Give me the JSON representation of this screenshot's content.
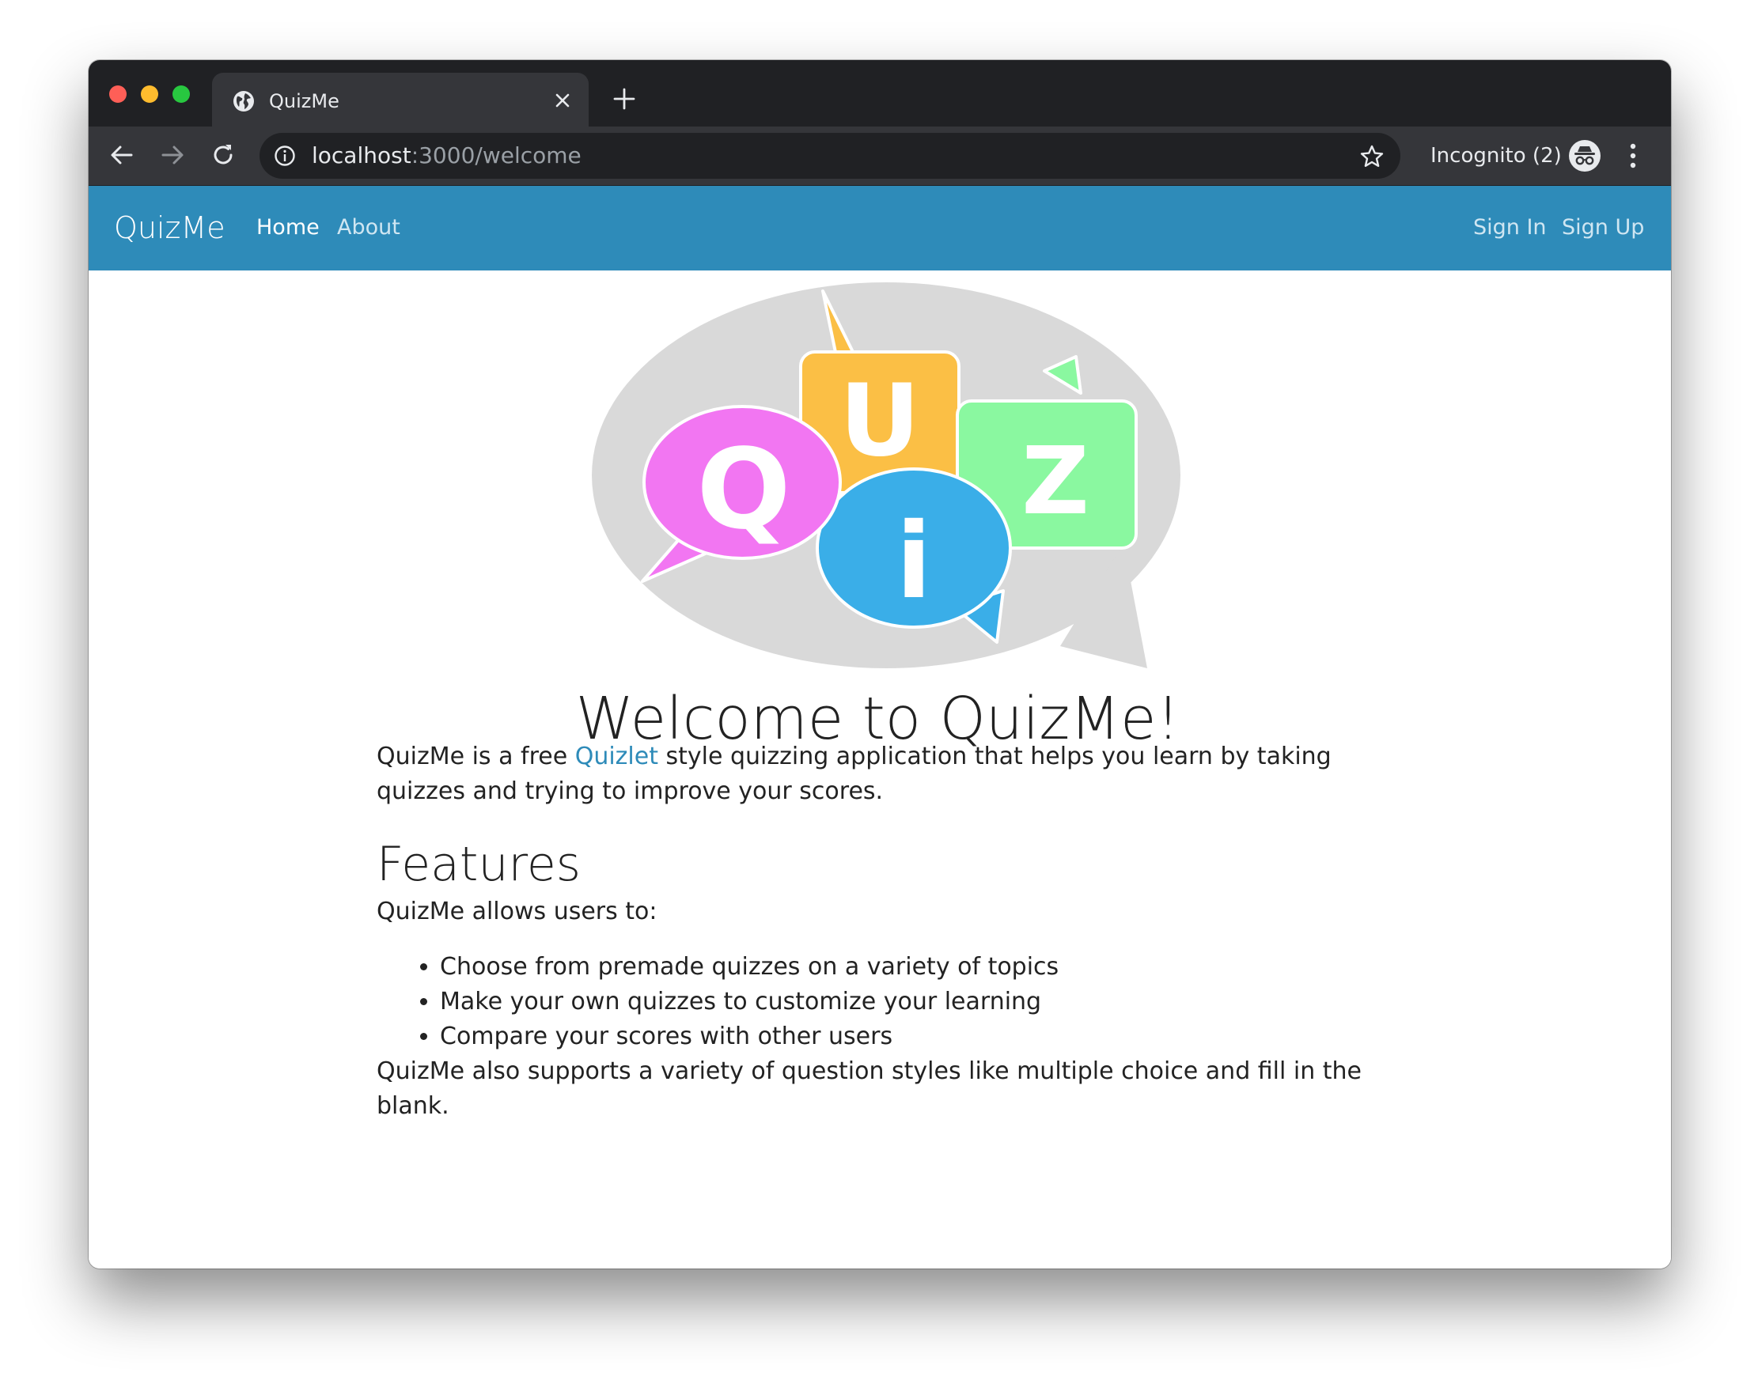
{
  "browser": {
    "tab_title": "QuizMe",
    "url_host": "localhost",
    "url_rest": ":3000/welcome",
    "incognito_label": "Incognito (2)"
  },
  "navbar": {
    "brand": "QuizMe",
    "links": [
      "Home",
      "About"
    ],
    "auth": [
      "Sign In",
      "Sign Up"
    ],
    "color": "#2e8bb9"
  },
  "logo": {
    "letters": [
      "Q",
      "U",
      "i",
      "Z"
    ],
    "colors": [
      "#f276f2",
      "#fbbf45",
      "#3aaee8",
      "#8af8a0",
      "#d9d9d9"
    ]
  },
  "main": {
    "heading": "Welcome to QuizMe!",
    "intro_before": "QuizMe is a free ",
    "intro_link": "Quizlet",
    "intro_after": " style quizzing application that helps you learn by taking quizzes and trying to improve your scores.",
    "features_heading": "Features",
    "features_intro": "QuizMe allows users to:",
    "features": [
      "Choose from premade quizzes on a variety of topics",
      "Make your own quizzes to customize your learning",
      "Compare your scores with other users"
    ],
    "closing": "QuizMe also supports a variety of question styles like multiple choice and fill in the blank."
  }
}
